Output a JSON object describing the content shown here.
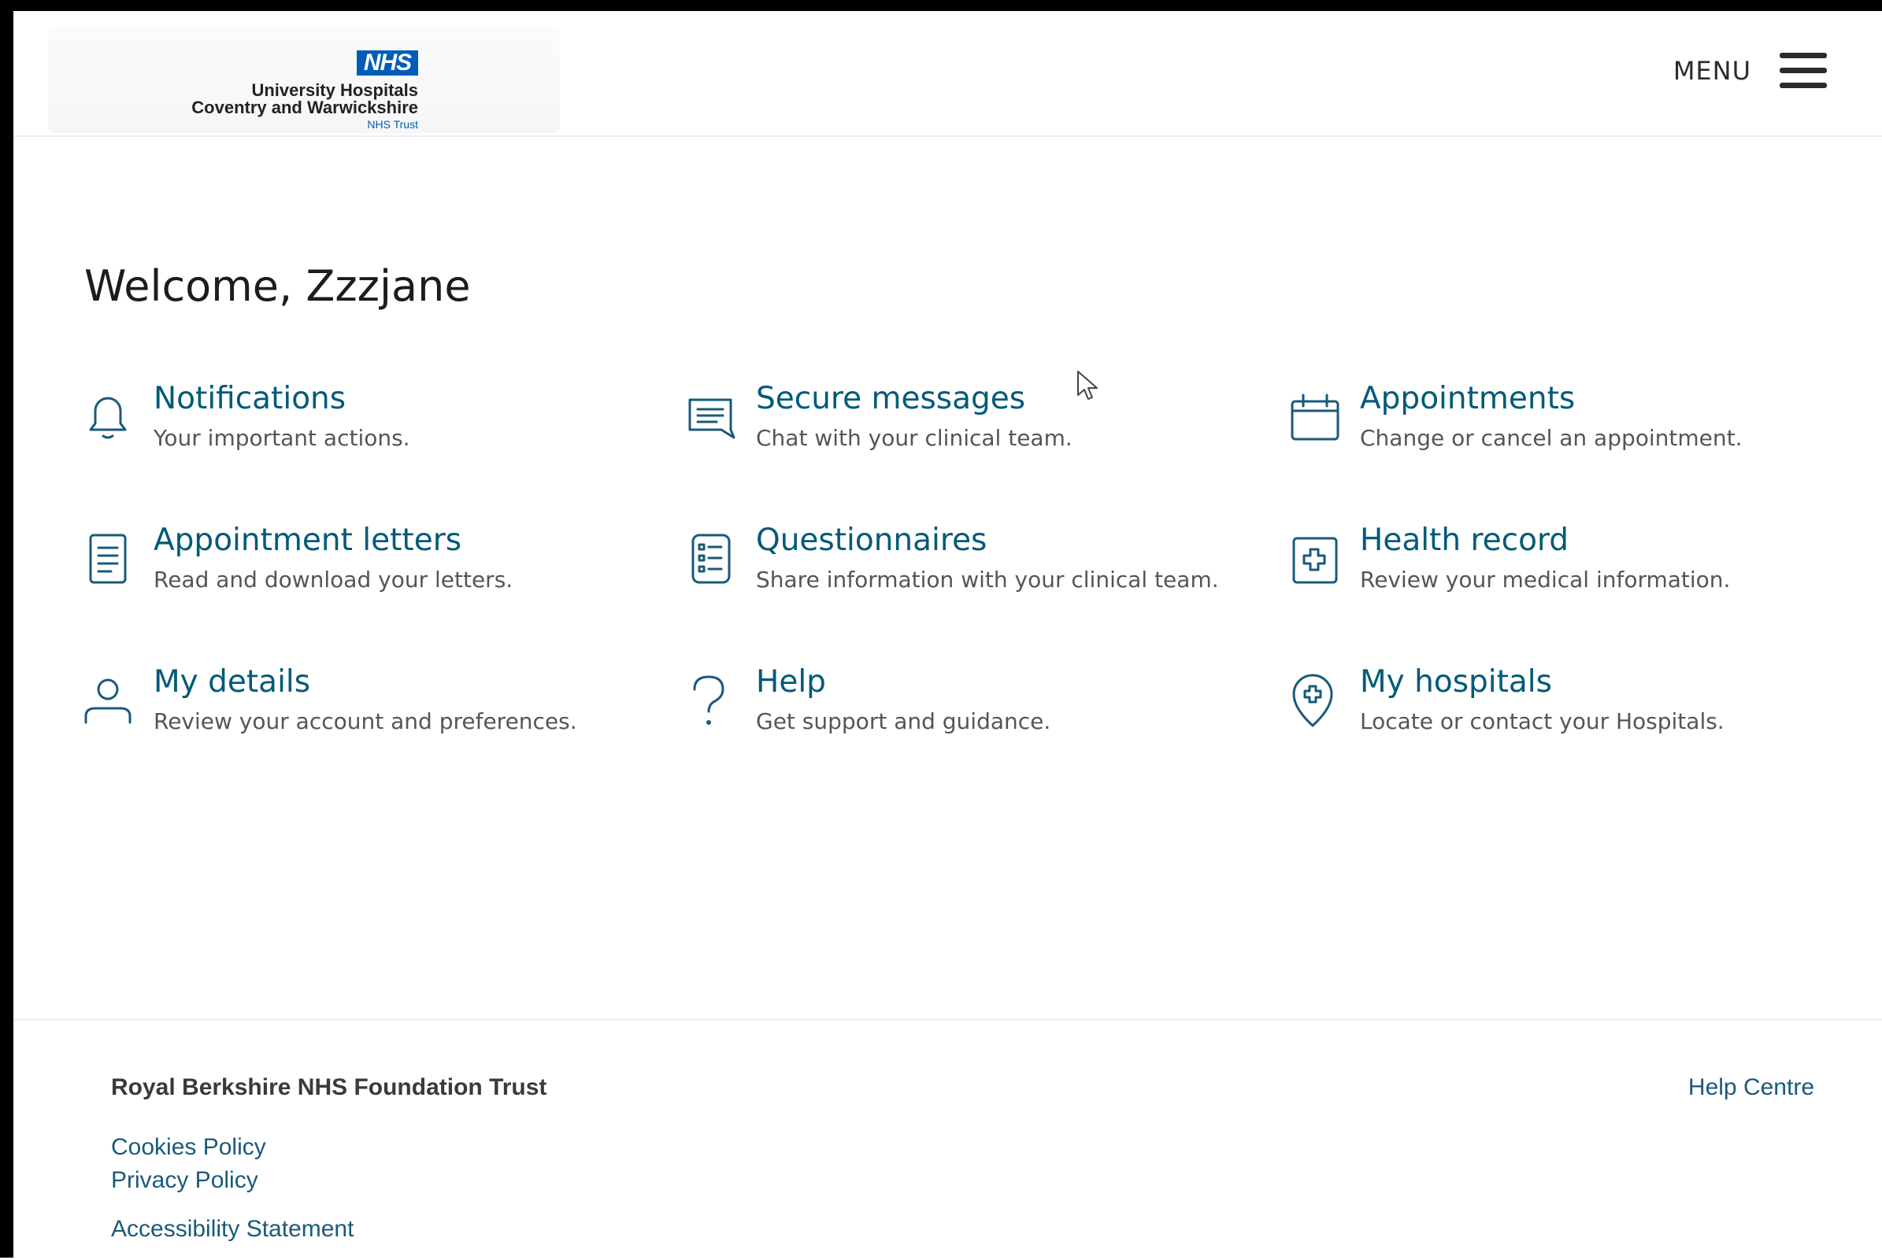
{
  "header": {
    "logo": {
      "badge": "NHS",
      "line1": "University Hospitals",
      "line2": "Coventry and Warwickshire",
      "line3": "NHS Trust"
    },
    "menu_label": "MENU"
  },
  "main": {
    "welcome": "Welcome, Zzzjane",
    "tiles": [
      {
        "title": "Notifications",
        "desc": "Your important actions.",
        "icon": "bell-icon"
      },
      {
        "title": "Secure messages",
        "desc": "Chat with your clinical team.",
        "icon": "message-icon"
      },
      {
        "title": "Appointments",
        "desc": "Change or cancel an appointment.",
        "icon": "calendar-icon"
      },
      {
        "title": "Appointment letters",
        "desc": "Read and download your letters.",
        "icon": "document-icon"
      },
      {
        "title": "Questionnaires",
        "desc": "Share information with your clinical team.",
        "icon": "checklist-icon"
      },
      {
        "title": "Health record",
        "desc": "Review your medical information.",
        "icon": "health-record-icon"
      },
      {
        "title": "My details",
        "desc": "Review your account and preferences.",
        "icon": "person-icon"
      },
      {
        "title": "Help",
        "desc": "Get support and guidance.",
        "icon": "question-icon"
      },
      {
        "title": "My hospitals",
        "desc": "Locate or contact your Hospitals.",
        "icon": "hospital-location-icon"
      }
    ]
  },
  "footer": {
    "trust_name": "Royal Berkshire NHS Foundation Trust",
    "help_centre": "Help Centre",
    "cookies": "Cookies Policy",
    "privacy": "Privacy Policy",
    "accessibility": "Accessibility Statement"
  },
  "colors": {
    "accent": "#005a78",
    "nhs_blue": "#005eb8",
    "text": "#2b2b2b"
  }
}
